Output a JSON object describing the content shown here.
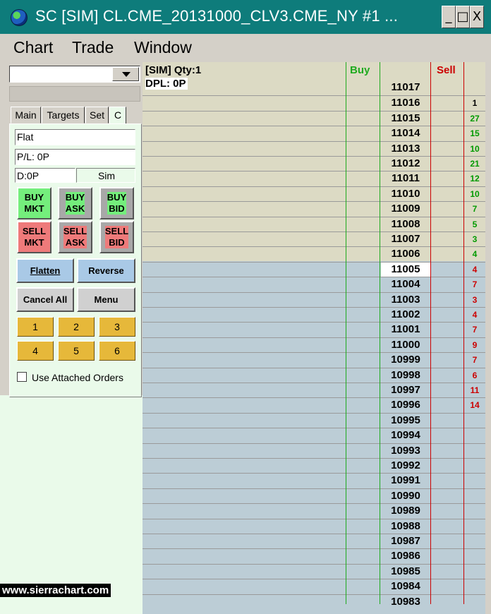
{
  "window": {
    "title": "SC [SIM] CL.CME_20131000_CLV3.CME_NY  #1  ...",
    "buttons": [
      "_",
      "□",
      "X"
    ]
  },
  "menu": [
    "Chart",
    "Trade",
    "Window"
  ],
  "panel": {
    "tabs": [
      "Main",
      "Targets",
      "Set",
      "C"
    ],
    "position_text": "Flat",
    "pl_text": "P/L: 0P",
    "daily_text": "D:0P",
    "mode_text": "Sim",
    "buy_buttons": [
      [
        "BUY",
        "MKT"
      ],
      [
        "BUY",
        "ASK"
      ],
      [
        "BUY",
        "BID"
      ]
    ],
    "sell_buttons": [
      [
        "SELL",
        "MKT"
      ],
      [
        "SELL",
        "ASK"
      ],
      [
        "SELL",
        "BID"
      ]
    ],
    "flatten_label": "Flatten",
    "reverse_label": "Reverse",
    "cancel_all_label": "Cancel All",
    "menu_label": "Menu",
    "number_buttons": [
      "1",
      "2",
      "3",
      "4",
      "5",
      "6"
    ],
    "attached_orders_label": "Use Attached Orders",
    "attached_orders_checked": false
  },
  "ladder": {
    "info_line1": "[SIM]  Qty:1",
    "info_line2": "DPL: 0P",
    "buy_header": "Buy",
    "sell_header": "Sell",
    "current_price": "11005",
    "colors": {
      "ask_zone": "#dcdac4",
      "bid_zone": "#bccdd6",
      "buy_green": "#1faa1f",
      "sell_red": "#cc0000",
      "ask_qty": "#009a00",
      "bid_qty": "#cc0000"
    },
    "rows": [
      {
        "price": "11017",
        "ask_qty": ""
      },
      {
        "price": "11016",
        "ask_qty": "1"
      },
      {
        "price": "11015",
        "ask_qty": "27"
      },
      {
        "price": "11014",
        "ask_qty": "15"
      },
      {
        "price": "11013",
        "ask_qty": "10"
      },
      {
        "price": "11012",
        "ask_qty": "21"
      },
      {
        "price": "11011",
        "ask_qty": "12"
      },
      {
        "price": "11010",
        "ask_qty": "10"
      },
      {
        "price": "11009",
        "ask_qty": "7"
      },
      {
        "price": "11008",
        "ask_qty": "5"
      },
      {
        "price": "11007",
        "ask_qty": "3"
      },
      {
        "price": "11006",
        "ask_qty": "4"
      },
      {
        "price": "11005",
        "bid_qty": "4"
      },
      {
        "price": "11004",
        "bid_qty": "7"
      },
      {
        "price": "11003",
        "bid_qty": "3"
      },
      {
        "price": "11002",
        "bid_qty": "4"
      },
      {
        "price": "11001",
        "bid_qty": "7"
      },
      {
        "price": "11000",
        "bid_qty": "9"
      },
      {
        "price": "10999",
        "bid_qty": "7"
      },
      {
        "price": "10998",
        "bid_qty": "6"
      },
      {
        "price": "10997",
        "bid_qty": "11"
      },
      {
        "price": "10996",
        "bid_qty": "14"
      },
      {
        "price": "10995",
        "bid_qty": ""
      },
      {
        "price": "10994",
        "bid_qty": ""
      },
      {
        "price": "10993",
        "bid_qty": ""
      },
      {
        "price": "10992",
        "bid_qty": ""
      },
      {
        "price": "10991",
        "bid_qty": ""
      },
      {
        "price": "10990",
        "bid_qty": ""
      },
      {
        "price": "10989",
        "bid_qty": ""
      },
      {
        "price": "10988",
        "bid_qty": ""
      },
      {
        "price": "10987",
        "bid_qty": ""
      },
      {
        "price": "10986",
        "bid_qty": ""
      },
      {
        "price": "10985",
        "bid_qty": ""
      },
      {
        "price": "10984",
        "bid_qty": ""
      },
      {
        "price": "10983",
        "bid_qty": ""
      }
    ]
  },
  "watermark": "www.sierrachart.com"
}
